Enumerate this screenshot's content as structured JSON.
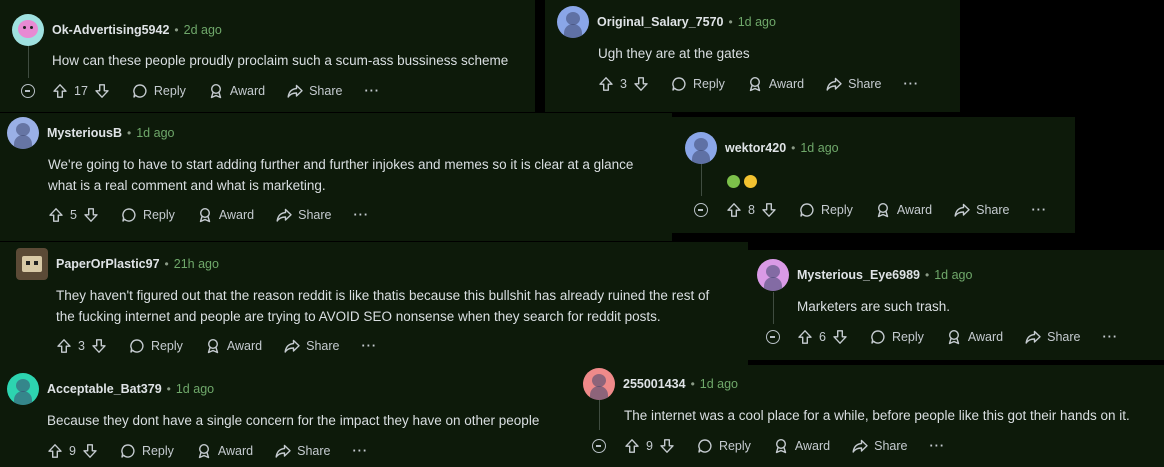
{
  "comments": [
    {
      "user": "Ok-Advertising5942",
      "age": "2d ago",
      "text": "How can these people proudly proclaim such a scum-ass bussiness scheme",
      "score": "17",
      "reply": "Reply",
      "award": "Award",
      "share": "Share",
      "more": "···"
    },
    {
      "user": "Original_Salary_7570",
      "age": "1d ago",
      "text": "Ugh they are at the gates",
      "score": "3",
      "reply": "Reply",
      "award": "Award",
      "share": "Share",
      "more": "···"
    },
    {
      "user": "MysteriousB",
      "age": "1d ago",
      "text_line1": "We're going to have to start adding further and further injokes and memes so it is clear at a glance",
      "text_line2": "what is a real comment and what is marketing.",
      "score": "5",
      "reply": "Reply",
      "award": "Award",
      "share": "Share",
      "more": "···"
    },
    {
      "user": "wektor420",
      "age": "1d ago",
      "text": "",
      "score": "8",
      "reply": "Reply",
      "award": "Award",
      "share": "Share",
      "more": "···"
    },
    {
      "user": "PaperOrPlastic97",
      "age": "21h ago",
      "text_line1": "They haven't figured out that the reason reddit is like thatis because this bullshit has already ruined the rest of",
      "text_line2": "the fucking internet and people are trying to AVOID SEO nonsense when they search for reddit posts.",
      "score": "3",
      "reply": "Reply",
      "award": "Award",
      "share": "Share",
      "more": "···"
    },
    {
      "user": "Mysterious_Eye6989",
      "age": "1d ago",
      "text": "Marketers are such trash.",
      "score": "6",
      "reply": "Reply",
      "award": "Award",
      "share": "Share",
      "more": "···"
    },
    {
      "user": "Acceptable_Bat379",
      "age": "1d ago",
      "text": "Because they dont have a single concern for the impact they have on other people",
      "score": "9",
      "reply": "Reply",
      "award": "Award",
      "share": "Share",
      "more": "···"
    },
    {
      "user": "255001434",
      "age": "1d ago",
      "text": "The internet was a cool place for a while, before people like this got their hands on it.",
      "score": "9",
      "reply": "Reply",
      "award": "Award",
      "share": "Share",
      "more": "···"
    }
  ],
  "meta": {
    "separator": "•"
  },
  "colors": {
    "card_bg": "#0d1a0a",
    "age": "#6fa86a",
    "thread": "#3f4c40"
  },
  "icons": [
    "snoo-avatar",
    "upvote-icon",
    "downvote-icon",
    "reply-bubble-icon",
    "award-icon",
    "share-arrow-icon",
    "collapse-icon",
    "sick-face-emoji",
    "crying-face-emoji"
  ]
}
